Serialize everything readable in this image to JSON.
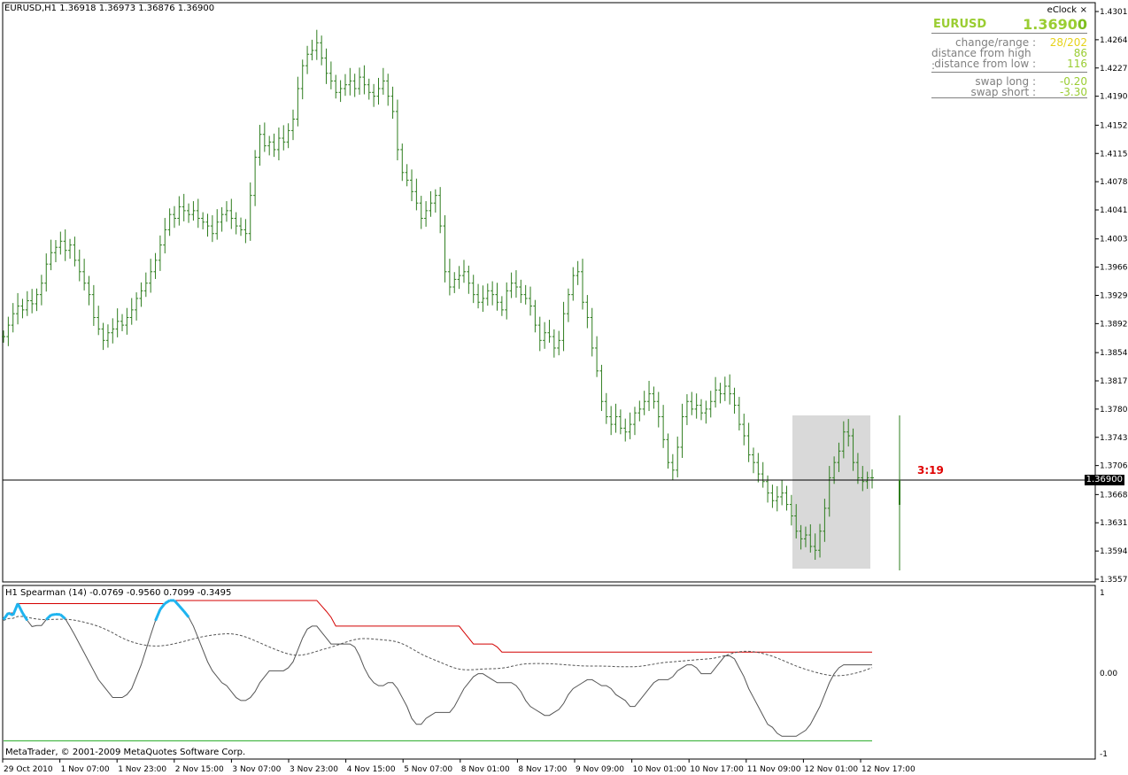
{
  "header": {
    "symbol_info": "EURUSD,H1  1.36918 1.36973 1.36876 1.36900"
  },
  "eclock": {
    "title": "eClock",
    "close_glyph": "×",
    "symbol": "EURUSD",
    "bid_main": "1.3690",
    "bid_last": "0",
    "rows": [
      {
        "key": "change/range :",
        "value": "28/202"
      },
      {
        "key": "distance from high :",
        "value": "86"
      },
      {
        "key": "distance from low :",
        "value": "116"
      },
      {
        "key": "swap long :",
        "value": "-0.20"
      },
      {
        "key": "swap short :",
        "value": "-3.30"
      }
    ]
  },
  "current_price": "1.36900",
  "timer": "3:19",
  "indicator": {
    "label": "H1 Spearman (14) -0.0769 -0.9560 0.7099 -0.3495"
  },
  "copyright": "MetaTrader, © 2001-2009 MetaQuotes Software Corp.",
  "colors": {
    "bar": "#2e7d1e",
    "spearman": "#555555",
    "upper_band": "#d40000",
    "lower_band": "#22aa22",
    "signal": "#555555",
    "hi_blue": "#1eb4f0",
    "lo_pink": "#e0609a",
    "timer": "#e00000",
    "eclock_green": "#9acd32",
    "eclock_yellow": "#e6d21a"
  },
  "chart_data": {
    "type": "ohlc",
    "price_axis": {
      "min": 1.3557,
      "max": 1.4301,
      "ticks": [
        "1.43010",
        "1.42640",
        "1.42270",
        "1.41900",
        "1.41520",
        "1.41150",
        "1.40780",
        "1.40410",
        "1.40030",
        "1.39660",
        "1.39290",
        "1.38920",
        "1.38540",
        "1.38170",
        "1.37800",
        "1.37430",
        "1.37060",
        "1.36680",
        "1.36310",
        "1.35940",
        "1.35570"
      ]
    },
    "time_labels": [
      "29 Oct 2010",
      "1 Nov 07:00",
      "1 Nov 23:00",
      "2 Nov 15:00",
      "3 Nov 07:00",
      "3 Nov 23:00",
      "4 Nov 15:00",
      "5 Nov 07:00",
      "8 Nov 01:00",
      "8 Nov 17:00",
      "9 Nov 09:00",
      "10 Nov 01:00",
      "10 Nov 17:00",
      "11 Nov 09:00",
      "12 Nov 01:00",
      "12 Nov 17:00"
    ],
    "closes": [
      1.3875,
      1.389,
      1.3905,
      1.3915,
      1.391,
      1.3922,
      1.3918,
      1.393,
      1.3945,
      1.397,
      1.3985,
      1.3992,
      1.4,
      1.3988,
      1.3995,
      1.3975,
      1.396,
      1.3945,
      1.393,
      1.39,
      1.3885,
      1.387,
      1.388,
      1.3885,
      1.3895,
      1.389,
      1.39,
      1.391,
      1.3925,
      1.3935,
      1.3945,
      1.396,
      1.3975,
      1.3995,
      1.4015,
      1.4035,
      1.403,
      1.4045,
      1.404,
      1.4035,
      1.404,
      1.403,
      1.4025,
      1.402,
      1.401,
      1.4025,
      1.4035,
      1.404,
      1.403,
      1.402,
      1.4015,
      1.401,
      1.406,
      1.411,
      1.414,
      1.4125,
      1.413,
      1.412,
      1.4135,
      1.413,
      1.4145,
      1.416,
      1.42,
      1.423,
      1.4245,
      1.425,
      1.426,
      1.424,
      1.422,
      1.421,
      1.4195,
      1.42,
      1.4205,
      1.421,
      1.42,
      1.4215,
      1.4205,
      1.4195,
      1.419,
      1.42,
      1.421,
      1.419,
      1.417,
      1.412,
      1.409,
      1.408,
      1.4065,
      1.405,
      1.403,
      1.404,
      1.405,
      1.406,
      1.402,
      1.396,
      1.394,
      1.395,
      1.3955,
      1.396,
      1.3945,
      1.393,
      1.392,
      1.3925,
      1.3935,
      1.393,
      1.392,
      1.391,
      1.3935,
      1.3945,
      1.394,
      1.393,
      1.3925,
      1.3915,
      1.389,
      1.387,
      1.388,
      1.3875,
      1.386,
      1.387,
      1.3905,
      1.393,
      1.3955,
      1.396,
      1.392,
      1.39,
      1.386,
      1.383,
      1.379,
      1.377,
      1.376,
      1.377,
      1.3755,
      1.375,
      1.376,
      1.3775,
      1.378,
      1.379,
      1.38,
      1.379,
      1.377,
      1.374,
      1.371,
      1.37,
      1.373,
      1.377,
      1.379,
      1.378,
      1.3785,
      1.3775,
      1.378,
      1.379,
      1.3805,
      1.38,
      1.381,
      1.38,
      1.3785,
      1.376,
      1.3745,
      1.372,
      1.371,
      1.3695,
      1.3685,
      1.367,
      1.366,
      1.3665,
      1.367,
      1.3655,
      1.364,
      1.362,
      1.361,
      1.3615,
      1.36,
      1.3595,
      1.362,
      1.365,
      1.369,
      1.371,
      1.3725,
      1.375,
      1.3745,
      1.371,
      1.369,
      1.3685,
      1.369,
      1.369
    ],
    "indicator_axis": {
      "ticks": [
        "1",
        "0.00",
        "-1"
      ]
    }
  }
}
